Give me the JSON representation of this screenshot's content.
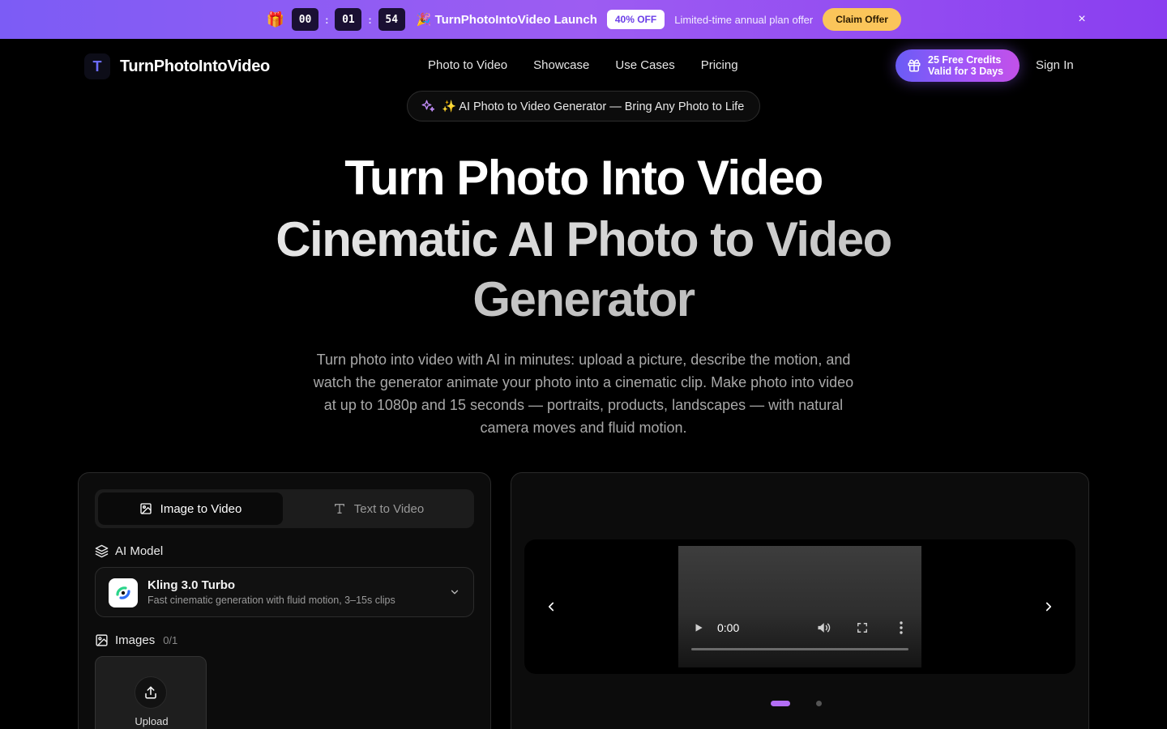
{
  "promo": {
    "countdown": [
      "00",
      "01",
      "54"
    ],
    "separator": ":",
    "title": "🎉 TurnPhotoIntoVideo Launch",
    "discount": "40% OFF",
    "subtitle": "Limited-time annual plan offer",
    "cta": "Claim Offer",
    "close": "×"
  },
  "nav": {
    "logo_mark": "T",
    "logo_text": "TurnPhotoIntoVideo",
    "links": [
      "Photo to Video",
      "Showcase",
      "Use Cases",
      "Pricing"
    ],
    "credits_line1": "25 Free Credits",
    "credits_line2": "Valid for 3 Days",
    "sign_in": "Sign In"
  },
  "hero": {
    "pill": "✨ AI Photo to Video Generator — Bring Any Photo to Life",
    "title_line1": "Turn Photo Into Video",
    "title_line2": "Cinematic AI Photo to Video",
    "title_line3": "Generator",
    "subtitle": "Turn photo into video with AI in minutes: upload a picture, describe the motion, and watch the generator animate your photo into a cinematic clip. Make photo into video at up to 1080p and 15 seconds — portraits, products, landscapes — with natural camera moves and fluid motion."
  },
  "form": {
    "tabs": [
      "Image to Video",
      "Text to Video"
    ],
    "active_tab": "Image to Video",
    "model_label": "AI Model",
    "model_name": "Kling 3.0 Turbo",
    "model_desc": "Fast cinematic generation with fluid motion, 3–15s clips",
    "images_label": "Images",
    "images_count": "0/1",
    "upload_label": "Upload"
  },
  "preview": {
    "video_time": "0:00",
    "slides_total": 2,
    "active_slide": 1
  },
  "colors": {
    "accent": "#a855f7",
    "claim": "#fbc55a"
  }
}
